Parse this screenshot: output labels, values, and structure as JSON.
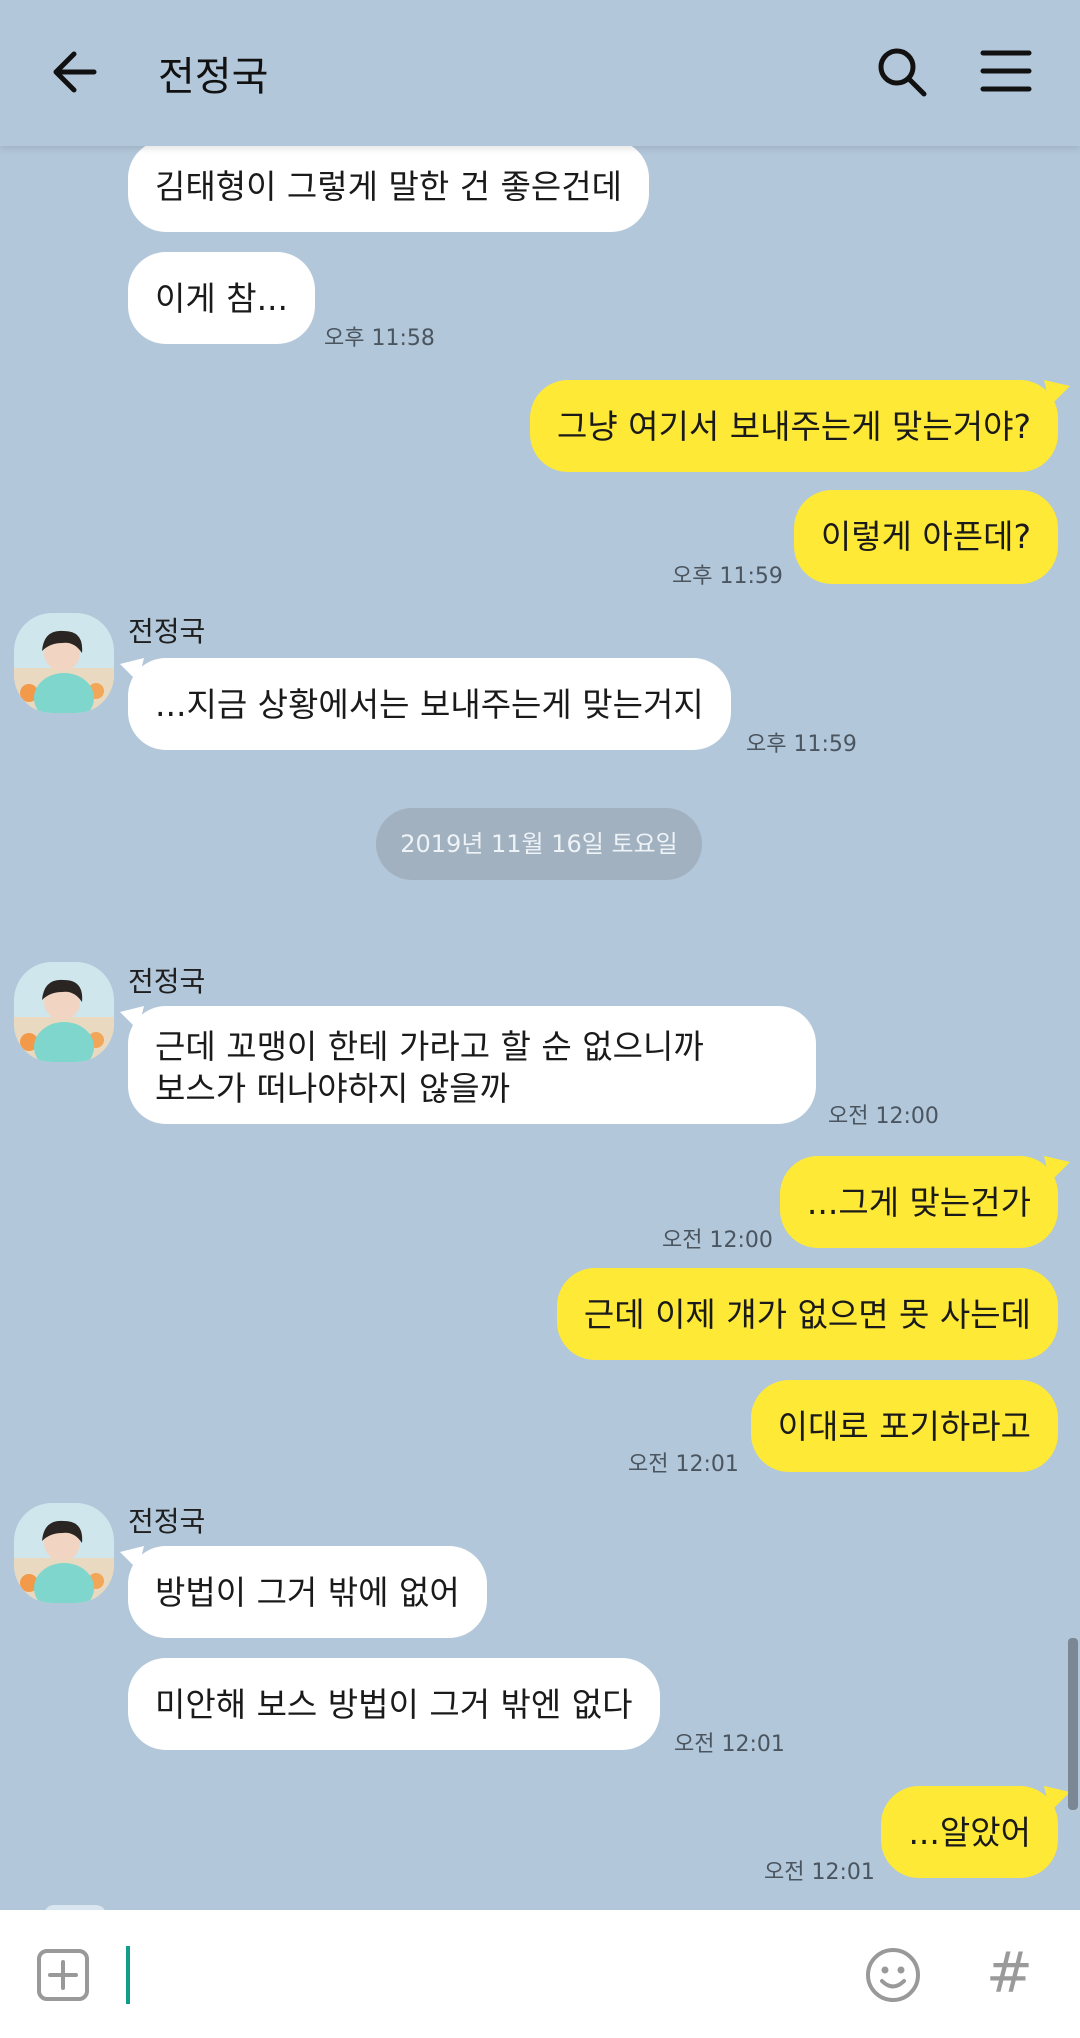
{
  "header": {
    "title": "전정국",
    "back_icon": "arrow-left-icon",
    "search_icon": "search-icon",
    "menu_icon": "hamburger-menu-icon"
  },
  "colors": {
    "background": "#b2c7da",
    "incoming_bubble": "#ffffff",
    "outgoing_bubble": "#fee936",
    "date_pill": "#a1b1c0",
    "cursor": "#129c8c"
  },
  "messages": [
    {
      "dir": "in",
      "text": "김태형이 그렇게 말한 건 좋은건데"
    },
    {
      "dir": "in",
      "text": "이게 참...",
      "time": "오후 11:58"
    },
    {
      "dir": "out",
      "text": "그냥 여기서 보내주는게 맞는거야?"
    },
    {
      "dir": "out",
      "text": "이렇게 아픈데?",
      "time": "오후 11:59"
    },
    {
      "dir": "in",
      "sender": "전정국",
      "text": "...지금 상황에서는 보내주는게 맞는거지",
      "time": "오후 11:59"
    },
    {
      "dir": "in",
      "sender": "전정국",
      "lines": [
        "근데 꼬맹이 한테 가라고 할 순 없으니까",
        "보스가 떠나야하지 않을까"
      ],
      "time": "오전 12:00"
    },
    {
      "dir": "out",
      "text": "...그게 맞는건가",
      "time": "오전 12:00"
    },
    {
      "dir": "out",
      "text": "근데 이제 걔가 없으면 못 사는데"
    },
    {
      "dir": "out",
      "text": "이대로 포기하라고",
      "time": "오전 12:01"
    },
    {
      "dir": "in",
      "sender": "전정국",
      "text": "방법이 그거 밖에 없어"
    },
    {
      "dir": "in",
      "text": "미안해 보스 방법이 그거 밖엔 없다",
      "time": "오전 12:01"
    },
    {
      "dir": "out",
      "text": "...알았어",
      "time": "오전 12:01"
    }
  ],
  "date_divider": "2019년 11월 16일 토요일",
  "input": {
    "plus_icon": "add-attachment-icon",
    "emoji_icon": "emoji-icon",
    "hash_icon": "hashtag-icon",
    "hash_glyph": "#"
  }
}
